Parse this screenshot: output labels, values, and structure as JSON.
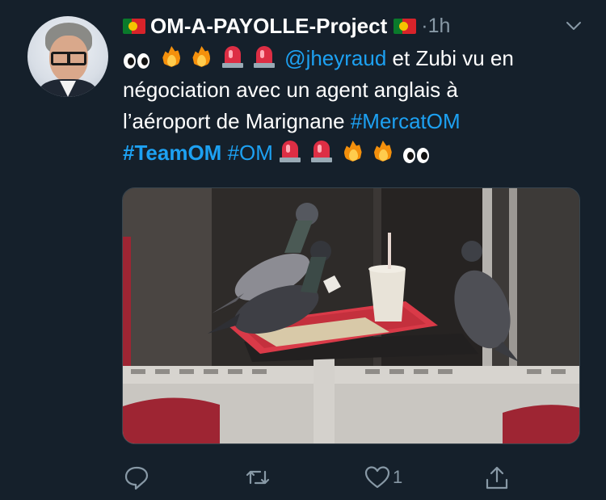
{
  "tweet": {
    "author_name": "OM-A-PAYOLLE-Project",
    "separator": "·",
    "time": "1h",
    "text": {
      "mention": "@jheyraud",
      "line1_rest": " et Zubi vu en",
      "line2": "négociation avec un agent anglais à",
      "line3": "l’aéroport de Marignane ",
      "hashtag1": "#MercatOM",
      "hashtag2": "#TeamOM",
      "hashtag3": "#OM"
    },
    "media": {
      "description_icon": "photo"
    }
  },
  "actions": {
    "reply_icon": "reply-icon",
    "retweet_icon": "retweet-icon",
    "like_icon": "like-icon",
    "like_count": "1",
    "share_icon": "share-icon"
  },
  "colors": {
    "background": "#15202b",
    "link": "#1da1f2",
    "muted": "#8899a6"
  }
}
